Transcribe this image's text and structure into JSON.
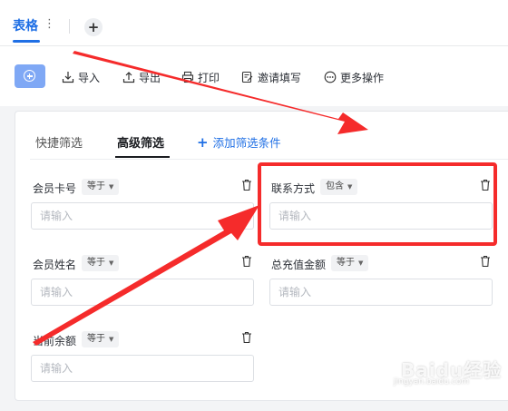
{
  "tabs": {
    "active_label": "表格",
    "more_icon": "⋮",
    "add_icon": "+"
  },
  "toolbar": {
    "import_label": "导入",
    "export_label": "导出",
    "print_label": "打印",
    "invite_label": "邀请填写",
    "more_label": "更多操作"
  },
  "filter": {
    "quick_tab": "快捷筛选",
    "advanced_tab": "高级筛选",
    "add_condition": "添加筛选条件"
  },
  "fields": [
    {
      "label": "会员卡号",
      "operator": "等于",
      "placeholder": "请输入"
    },
    {
      "label": "联系方式",
      "operator": "包含",
      "placeholder": "请输入"
    },
    {
      "label": "会员姓名",
      "operator": "等于",
      "placeholder": "请输入"
    },
    {
      "label": "总充值金额",
      "operator": "等于",
      "placeholder": "请输入"
    },
    {
      "label": "当前余额",
      "operator": "等于",
      "placeholder": "请输入"
    }
  ],
  "watermark": {
    "brand": "Baidu经验",
    "sub": "jingyan.baidu.com"
  },
  "colors": {
    "accent": "#1f6fe5",
    "annotation_red": "#f52b2b",
    "primary_button": "#7fa8f5"
  }
}
